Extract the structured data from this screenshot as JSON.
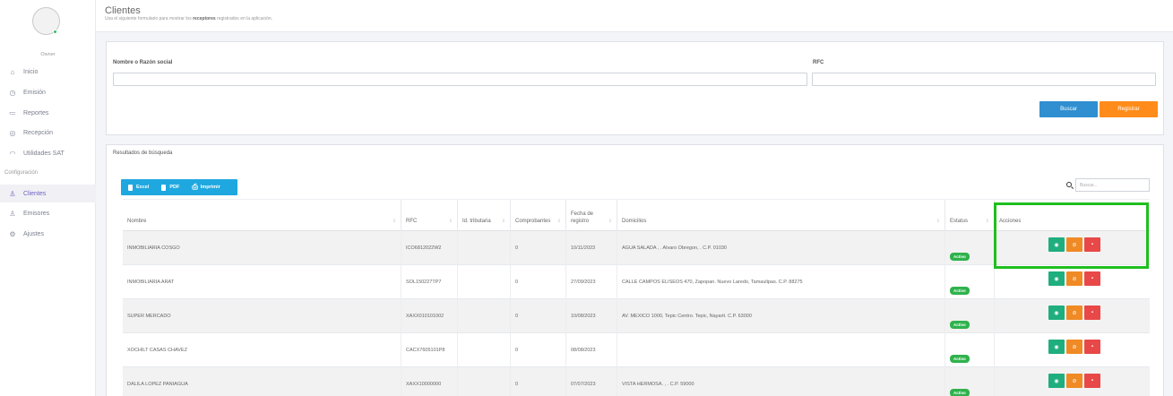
{
  "sidebar": {
    "role": "Owner",
    "items": [
      {
        "label": "Inicio",
        "icon": "home-icon",
        "glyph": "⌂"
      },
      {
        "label": "Emisión",
        "icon": "clock-icon",
        "glyph": "◷"
      },
      {
        "label": "Reportes",
        "icon": "list-icon",
        "glyph": "≔"
      },
      {
        "label": "Recepción",
        "icon": "inbox-icon",
        "glyph": "◎"
      },
      {
        "label": "Utilidades SAT",
        "icon": "gauge-icon",
        "glyph": "◠"
      }
    ],
    "section": "Configuración",
    "config_items": [
      {
        "label": "Clientes",
        "icon": "user-icon",
        "glyph": "♙",
        "active": true
      },
      {
        "label": "Emisores",
        "icon": "user-icon",
        "glyph": "♙"
      },
      {
        "label": "Ajustes",
        "icon": "gear-icon",
        "glyph": "⚙"
      }
    ]
  },
  "header": {
    "title": "Clientes",
    "subtitle_pre": "Usa el siguiente formulario para mostrar los ",
    "subtitle_bold": "receptores",
    "subtitle_post": " registrados en la aplicación."
  },
  "search_form": {
    "name_label": "Nombre o Razón social",
    "name_value": "",
    "rfc_label": "RFC",
    "rfc_value": "",
    "search_button": "Buscar",
    "register_button": "Registrar"
  },
  "results": {
    "title": "Resultados de búsqueda",
    "export": {
      "excel": "Excel",
      "pdf": "PDF",
      "print": "Imprimir"
    },
    "search_placeholder": "Buscar...",
    "columns": [
      "Nombre",
      "RFC",
      "Id. tributaria",
      "Comprobantes",
      "Fecha de registro",
      "Domicilios",
      "Estatus",
      "Acciones"
    ],
    "rows": [
      {
        "nombre": "INMOBILIARIA COSGO",
        "rfc": "ICO6812022W2",
        "id_trib": "",
        "comprobantes": "0",
        "fecha": "10/11/2023",
        "domicilio": "AGUA SALADA , . Alvaro Obregon, . C.P. 01030",
        "estatus": "Activo"
      },
      {
        "nombre": "INMOBILIARIA ARAT",
        "rfc": "SOL150227TP7",
        "id_trib": "",
        "comprobantes": "0",
        "fecha": "27/09/2023",
        "domicilio": "CALLE CAMPOS ELISEOS 470, Zapopan. Nuevo Laredo, Tamaulipas. C.P. 88275",
        "estatus": "Activo"
      },
      {
        "nombre": "SUPER MERCADO",
        "rfc": "XAXX010101002",
        "id_trib": "",
        "comprobantes": "0",
        "fecha": "10/08/2023",
        "domicilio": "AV. MEXICO 1000, Tepic Centro. Tepic, Nayarit. C.P. 63000",
        "estatus": "Activo"
      },
      {
        "nombre": "XOCHILT CASAS CHAVEZ",
        "rfc": "CACX7605101P8",
        "id_trib": "",
        "comprobantes": "0",
        "fecha": "08/08/2023",
        "domicilio": "",
        "estatus": "Activo"
      },
      {
        "nombre": "DALILA LOPEZ PANIAGUA",
        "rfc": "XAXX10000000",
        "id_trib": "",
        "comprobantes": "0",
        "fecha": "07/07/2023",
        "domicilio": "VISTA HERMOSA. , . C.P. 59000",
        "estatus": "Activo"
      }
    ],
    "action_glyphs": {
      "view": "◉",
      "disable": "⊘",
      "delete": "▪"
    }
  },
  "colors": {
    "accent": "#6c63c4",
    "active_badge": "#2fb24c",
    "highlight": "#1fbf1f"
  }
}
